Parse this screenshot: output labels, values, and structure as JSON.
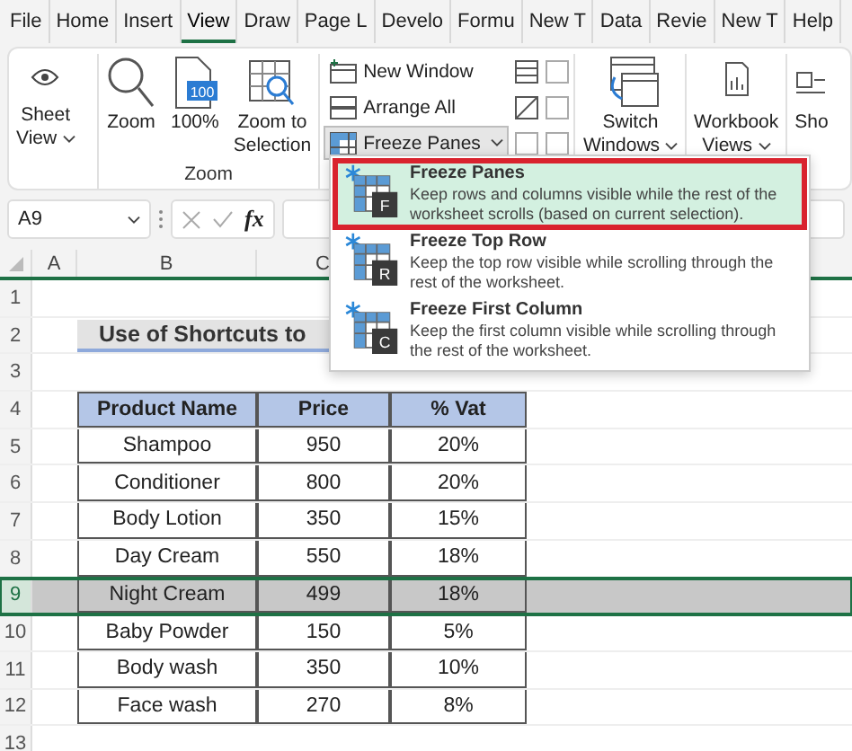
{
  "tabs": [
    {
      "label": "File",
      "selected": false
    },
    {
      "label": "Home",
      "selected": false
    },
    {
      "label": "Insert",
      "selected": false
    },
    {
      "label": "View",
      "selected": true
    },
    {
      "label": "Draw",
      "selected": false
    },
    {
      "label": "Page L",
      "selected": false
    },
    {
      "label": "Develo",
      "selected": false
    },
    {
      "label": "Formu",
      "selected": false
    },
    {
      "label": "New T",
      "selected": false
    },
    {
      "label": "Data",
      "selected": false
    },
    {
      "label": "Revie",
      "selected": false
    },
    {
      "label": "New T",
      "selected": false
    },
    {
      "label": "Help",
      "selected": false
    }
  ],
  "ribbon": {
    "sheet_view": {
      "line1": "Sheet",
      "line2": "View"
    },
    "zoom_group": {
      "label": "Zoom",
      "zoom": "Zoom",
      "hundred": "100%",
      "hundred_icon_text": "100",
      "zoom_selection": [
        "Zoom to",
        "Selection"
      ]
    },
    "window_group": {
      "new_window": "New Window",
      "arrange_all": "Arrange All",
      "freeze_panes": {
        "label": "Freeze Panes",
        "pressed": true
      }
    },
    "switch_windows": [
      "Switch",
      "Windows"
    ],
    "workbook_views": [
      "Workbook",
      "Views"
    ],
    "show": "Sho"
  },
  "freeze_menu": [
    {
      "title": "Freeze Panes",
      "description": "Keep rows and columns visible while the rest of the worksheet scrolls (based on current selection).",
      "letter": "F",
      "selected": true
    },
    {
      "title": "Freeze Top Row",
      "description": "Keep the top row visible while scrolling through the rest of the worksheet.",
      "letter": "R",
      "selected": false
    },
    {
      "title": "Freeze First Column",
      "description": "Keep the first column visible while scrolling through the rest of the worksheet.",
      "letter": "C",
      "selected": false
    }
  ],
  "formula_bar": {
    "name_box": "A9",
    "fx": "fx"
  },
  "sheet": {
    "columns": [
      "A",
      "B",
      "C"
    ],
    "rows": [
      {
        "number": "1",
        "kind": "empty",
        "selected": false
      },
      {
        "number": "2",
        "kind": "title",
        "text": "Use of Shortcuts to",
        "selected": false
      },
      {
        "number": "3",
        "kind": "empty",
        "selected": false
      },
      {
        "number": "4",
        "kind": "header",
        "cells": [
          "Product Name",
          "Price",
          "% Vat"
        ],
        "selected": false
      },
      {
        "number": "5",
        "kind": "data",
        "cells": [
          "Shampoo",
          "950",
          "20%"
        ],
        "selected": false
      },
      {
        "number": "6",
        "kind": "data",
        "cells": [
          "Conditioner",
          "800",
          "20%"
        ],
        "selected": false
      },
      {
        "number": "7",
        "kind": "data",
        "cells": [
          "Body Lotion",
          "350",
          "15%"
        ],
        "selected": false
      },
      {
        "number": "8",
        "kind": "data",
        "cells": [
          "Day Cream",
          "550",
          "18%"
        ],
        "selected": false
      },
      {
        "number": "9",
        "kind": "data",
        "cells": [
          "Night Cream",
          "499",
          "18%"
        ],
        "selected": true
      },
      {
        "number": "10",
        "kind": "data",
        "cells": [
          "Baby Powder",
          "150",
          "5%"
        ],
        "selected": false
      },
      {
        "number": "11",
        "kind": "data",
        "cells": [
          "Body wash",
          "350",
          "10%"
        ],
        "selected": false
      },
      {
        "number": "12",
        "kind": "data",
        "cells": [
          "Face wash",
          "270",
          "8%"
        ],
        "selected": false
      },
      {
        "number": "13",
        "kind": "empty",
        "selected": false
      }
    ]
  }
}
